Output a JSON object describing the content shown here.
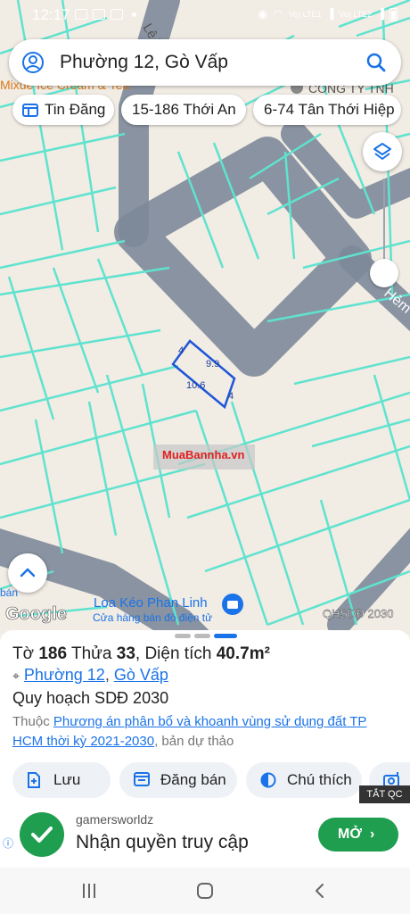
{
  "status_bar": {
    "time": "12:17",
    "lte1": "Vo) LTE1",
    "lte2": "Vo) LTE2"
  },
  "search": {
    "value": "Phường 12, Gò Vấp"
  },
  "chips": [
    {
      "label": "Tin Đăng"
    },
    {
      "label": "15-186 Thới An"
    },
    {
      "label": "6-74 Tân Thới Hiệp"
    }
  ],
  "map": {
    "poi_top_left": "Mixue Ice Cream & Tea",
    "poi_top_right": "CÔNG TY TNH",
    "street_top": "Lê Văn Huy",
    "street_right": "Hẻm",
    "parcel_labels": {
      "side_a": "4",
      "side_b": "9.9",
      "side_c": "10.6",
      "side_d": "4"
    },
    "watermark": "MuaBannha.vn",
    "poi_bottom_title": "Loa Kéo Phan Linh",
    "poi_bottom_sub": "Cửa hàng bán đồ điện tử",
    "poi_bottom_left": "bán",
    "google": "Google",
    "layer_badge": "QHSDĐ 2030"
  },
  "sheet": {
    "to_label": "Tờ",
    "to_value": "186",
    "thua_label": "Thửa",
    "thua_value": "33",
    "dt_label": "Diện tích",
    "dt_value": "40.7m²",
    "ward": "Phường 12",
    "district": "Gò Vấp",
    "plan": "Quy hoạch SDĐ 2030",
    "desc_prefix": "Thuộc",
    "desc_link": "Phương án phân bổ và khoanh vùng sử dụng đất TP HCM thời kỳ 2021-2030",
    "desc_suffix": ", bản dự thảo",
    "actions": {
      "save": "Lưu",
      "post": "Đăng bán",
      "legend": "Chú thích"
    }
  },
  "ad": {
    "hide": "TẮT QC",
    "source": "gamersworldz",
    "title": "Nhận quyền truy cập",
    "cta": "MỞ"
  },
  "colors": {
    "parcel": "#5fe3cf",
    "road": "#7d8a99",
    "link": "#1a73e8",
    "cta": "#1e9e4e"
  }
}
